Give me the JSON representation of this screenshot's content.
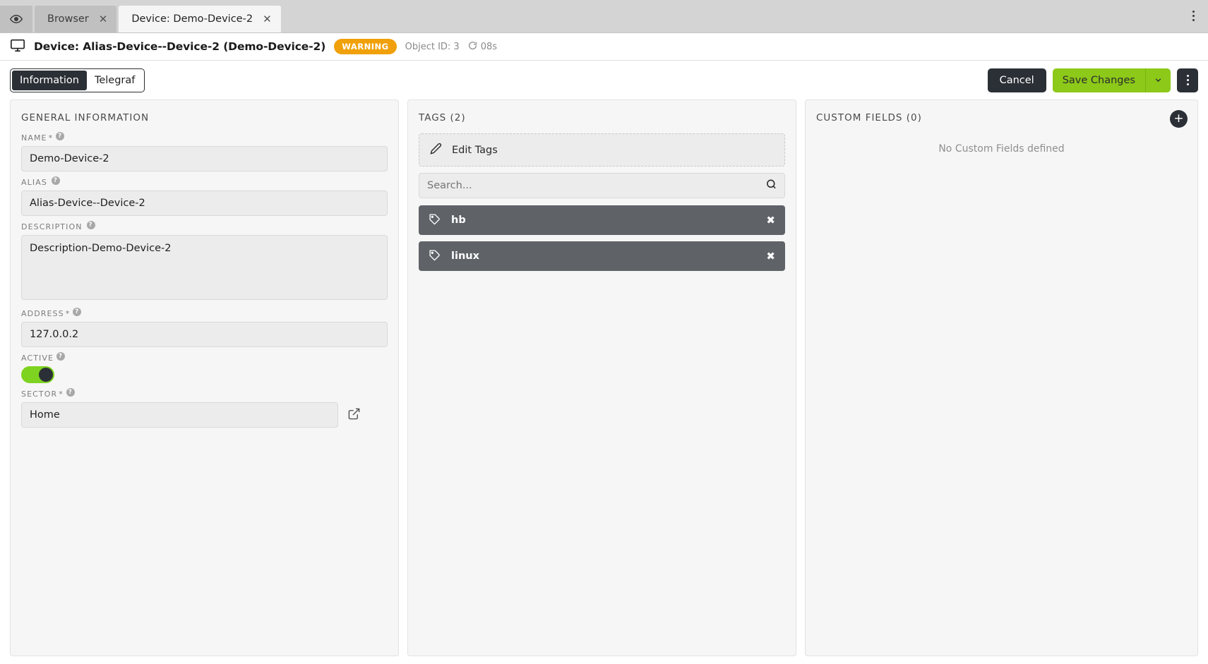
{
  "tabbar": {
    "eye_icon": "eye-icon",
    "tabs": [
      {
        "label": "Browser",
        "close": "✕",
        "active": false
      },
      {
        "label": "Device: Demo-Device-2",
        "close": "✕",
        "active": true
      }
    ],
    "kebab": "more-options-icon"
  },
  "objheader": {
    "monitor_icon": "monitor-icon",
    "title": "Device: Alias-Device--Device-2 (Demo-Device-2)",
    "status_badge": "WARNING",
    "object_id": "Object ID: 3",
    "refresh_timer": "08s",
    "badge_color": "#f0a00a"
  },
  "actionbar": {
    "tabs": [
      {
        "label": "Information",
        "active": true
      },
      {
        "label": "Telegraf",
        "active": false
      }
    ],
    "cancel_label": "Cancel",
    "save_label": "Save Changes",
    "save_caret": "⌄",
    "accent_green": "#8cc919",
    "dark": "#2b3036"
  },
  "general": {
    "title": "GENERAL INFORMATION",
    "fields": [
      {
        "label": "NAME",
        "required": "*",
        "value": "Demo-Device-2",
        "type": "text"
      },
      {
        "label": "ALIAS",
        "required": "",
        "value": "Alias-Device--Device-2",
        "type": "text"
      },
      {
        "label": "DESCRIPTION",
        "required": "",
        "value": "Description-Demo-Device-2",
        "type": "textarea"
      },
      {
        "label": "ADDRESS",
        "required": "*",
        "value": "127.0.0.2",
        "type": "text"
      }
    ],
    "active_label": "ACTIVE",
    "active_state": true,
    "sector_label": "SECTOR",
    "sector_required": "*",
    "sector_value": "Home",
    "help_icon": "?"
  },
  "tags": {
    "title": "TAGS (2)",
    "edit_label": "Edit Tags",
    "edit_icon": "pencil-icon",
    "search_placeholder": "Search...",
    "search_value": "",
    "search_icon": "search-icon",
    "items": [
      {
        "name": "hb",
        "icon": "tag-icon",
        "remove": "✖"
      },
      {
        "name": "linux",
        "icon": "tag-icon",
        "remove": "✖"
      }
    ]
  },
  "custom_fields": {
    "title": "CUSTOM FIELDS (0)",
    "add_label": "+",
    "empty_text": "No Custom Fields defined"
  }
}
